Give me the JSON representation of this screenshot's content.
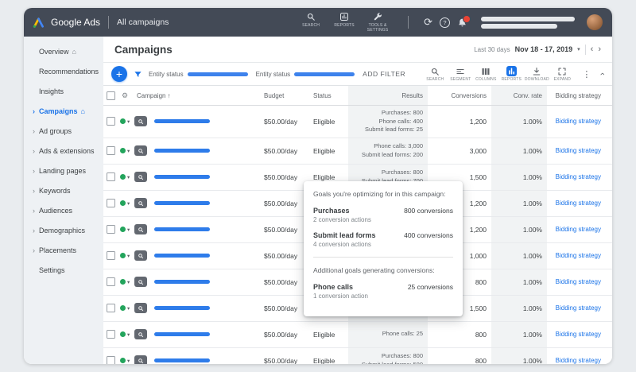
{
  "topbar": {
    "brand": "Google Ads",
    "page_title": "All campaigns",
    "actions": [
      {
        "icon": "search",
        "label": "SEARCH"
      },
      {
        "icon": "reports",
        "label": "REPORTS"
      },
      {
        "icon": "tools",
        "label": "TOOLS & SETTINGS"
      }
    ]
  },
  "sidebar": {
    "items": [
      {
        "label": "Overview",
        "home": true
      },
      {
        "label": "Recommendations"
      },
      {
        "label": "Insights"
      },
      {
        "label": "Campaigns",
        "selected": true,
        "expandable": true,
        "home": true
      },
      {
        "label": "Ad groups",
        "expandable": true
      },
      {
        "label": "Ads & extensions",
        "expandable": true
      },
      {
        "label": "Landing pages",
        "expandable": true
      },
      {
        "label": "Keywords",
        "expandable": true
      },
      {
        "label": "Audiences",
        "expandable": true
      },
      {
        "label": "Demographics",
        "expandable": true
      },
      {
        "label": "Placements",
        "expandable": true
      },
      {
        "label": "Settings"
      }
    ]
  },
  "page": {
    "title": "Campaigns",
    "date_preset": "Last 30 days",
    "date_range": "Nov 18 - 17, 2019"
  },
  "filterbar": {
    "filters": [
      {
        "label": "Entity status"
      },
      {
        "label": "Entity status"
      }
    ],
    "add_filter_label": "ADD FILTER",
    "tools": [
      {
        "icon": "search",
        "label": "SEARCH"
      },
      {
        "icon": "segment",
        "label": "SEGMENT"
      },
      {
        "icon": "columns",
        "label": "COLUMNS"
      },
      {
        "icon": "reports",
        "label": "REPORTS"
      },
      {
        "icon": "download",
        "label": "DOWNLOAD"
      },
      {
        "icon": "expand",
        "label": "EXPAND"
      }
    ]
  },
  "table": {
    "columns": {
      "campaign": "Campaign",
      "budget": "Budget",
      "status": "Status",
      "results": "Results",
      "conversions": "Conversions",
      "conv_rate": "Conv. rate",
      "bidding": "Bidding strategy"
    },
    "rows": [
      {
        "budget": "$50.00/day",
        "status": "Eligible",
        "results": [
          "Purchases: 800",
          "Phone calls: 400",
          "Submit lead forms: 25"
        ],
        "conversions": "1,200",
        "conv_rate": "1.00%",
        "bidding": "Bidding strategy"
      },
      {
        "budget": "$50.00/day",
        "status": "Eligible",
        "results": [
          "Phone calls: 3,000",
          "Submit lead forms: 200"
        ],
        "conversions": "3,000",
        "conv_rate": "1.00%",
        "bidding": "Bidding strategy"
      },
      {
        "budget": "$50.00/day",
        "status": "Eligible",
        "results": [
          "Purchases: 800",
          "Submit lead forms: 700"
        ],
        "conversions": "1,500",
        "conv_rate": "1.00%",
        "bidding": "Bidding strategy"
      },
      {
        "budget": "$50.00/day",
        "status": "Eligible",
        "results": [],
        "conversions": "1,200",
        "conv_rate": "1.00%",
        "bidding": "Bidding strategy"
      },
      {
        "budget": "$50.00/day",
        "status": "Eligible",
        "results": [],
        "conversions": "1,200",
        "conv_rate": "1.00%",
        "bidding": "Bidding strategy"
      },
      {
        "budget": "$50.00/day",
        "status": "Eligible",
        "results": [],
        "conversions": "1,000",
        "conv_rate": "1.00%",
        "bidding": "Bidding strategy"
      },
      {
        "budget": "$50.00/day",
        "status": "Eligible",
        "results": [],
        "conversions": "800",
        "conv_rate": "1.00%",
        "bidding": "Bidding strategy"
      },
      {
        "budget": "$50.00/day",
        "status": "Eligible",
        "results": [],
        "conversions": "1,500",
        "conv_rate": "1.00%",
        "bidding": "Bidding strategy"
      },
      {
        "budget": "$50.00/day",
        "status": "Eligible",
        "results": [
          "Phone calls: 25"
        ],
        "conversions": "800",
        "conv_rate": "1.00%",
        "bidding": "Bidding strategy"
      },
      {
        "budget": "$50.00/day",
        "status": "Eligible",
        "results": [
          "Purchases: 800",
          "Submit lead forms: 500"
        ],
        "conversions": "800",
        "conv_rate": "1.00%",
        "bidding": "Bidding strategy"
      }
    ]
  },
  "tooltip": {
    "title": "Goals you're optimizing for in this campaign:",
    "goals": [
      {
        "name": "Purchases",
        "value": "800 conversions",
        "detail": "2 conversion actions"
      },
      {
        "name": "Submit lead forms",
        "value": "400 conversions",
        "detail": "4 conversion actions"
      }
    ],
    "additional_title": "Additional goals generating conversions:",
    "additional_goals": [
      {
        "name": "Phone calls",
        "value": "25 conversions",
        "detail": "1 conversion action"
      }
    ]
  },
  "colors": {
    "accent_blue": "#1a73e8",
    "status_green": "#23a45c",
    "alert_red": "#ea4335"
  }
}
